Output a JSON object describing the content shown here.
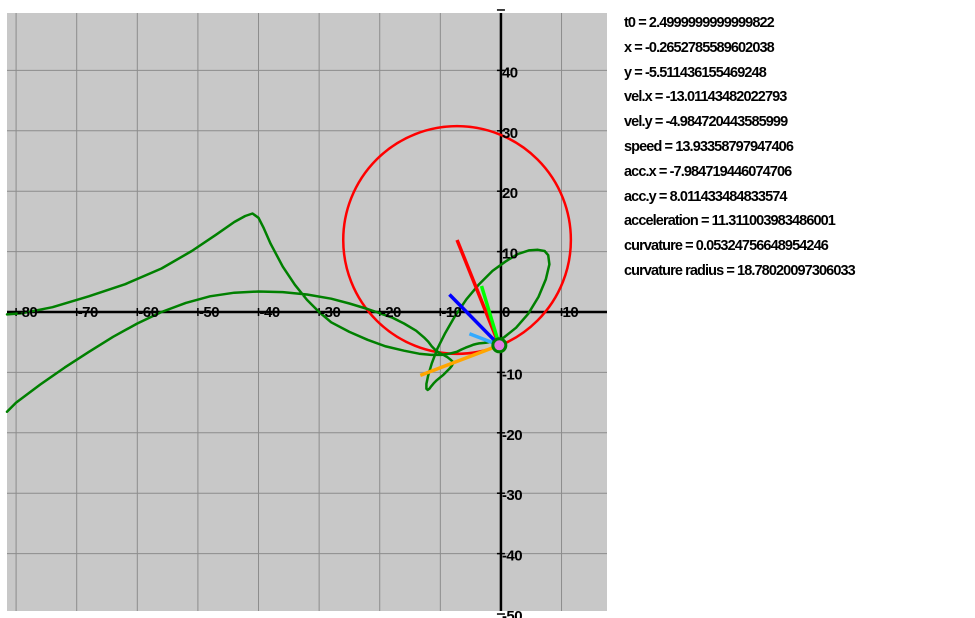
{
  "readout": {
    "t0": "t0 = 2.4999999999999822",
    "x": "x = -0.2652785589602038",
    "y": "y = -5.511436155469248",
    "vel_x": "vel.x = -13.01143482022793",
    "vel_y": "vel.y = -4.984720443585999",
    "speed": "speed = 13.93358797947406",
    "acc_x": "acc.x = -7.984719446074706",
    "acc_y": "acc.y = 8.011433484833574",
    "acceleration": "acceleration = 11.311003983486001",
    "curvature": "curvature = 0.05324756648954246",
    "curvature_radius": "curvature radius = 18.78020097306033"
  },
  "chart_data": {
    "type": "line",
    "xlim": [
      -81.5,
      17.5
    ],
    "ylim": [
      -49.5,
      49.5
    ],
    "grid": true,
    "background": "#c8c8c8",
    "grid_color": "#8c8c8c",
    "x_ticks": [
      -80,
      -70,
      -60,
      -50,
      -40,
      -30,
      -20,
      -10,
      0,
      10
    ],
    "y_ticks": [
      -50,
      -40,
      -30,
      -20,
      -10,
      10,
      20,
      30,
      40
    ],
    "x_tick_labels": [
      "-80",
      "-70",
      "-60",
      "-50",
      "-40",
      "-30",
      "-20",
      "-10",
      "0",
      "10"
    ],
    "y_tick_labels": [
      "-50",
      "-40",
      "-30",
      "-20",
      "-10",
      "10",
      "20",
      "30",
      "40"
    ],
    "trajectory": {
      "color": "#008000",
      "x": [
        -81.5,
        -79,
        -74,
        -68,
        -62,
        -56,
        -51,
        -47,
        -44,
        -42.2,
        -41,
        -40,
        -39.2,
        -38,
        -36,
        -34,
        -32,
        -30,
        -28,
        -25,
        -22,
        -19,
        -16,
        -13.5,
        -11.5,
        -9.8,
        -8.5,
        -7.3,
        -6.5,
        -5.8,
        -5,
        -4.5,
        -4.1,
        -3.6,
        -2.5,
        -1,
        0.5,
        2.5,
        4.5,
        6.2,
        7.4,
        8,
        7.8,
        7.2,
        6.1,
        4.6,
        2.8,
        0.8,
        -1.4,
        -3.6,
        -5.7,
        -7.6,
        -9.2,
        -10.5,
        -11.4,
        -12,
        -12.3,
        -12.3,
        -12.1,
        -11.8,
        -11.5,
        -11.1,
        -10.6,
        -10.1,
        -9.5,
        -9,
        -8.5,
        -8.1,
        -7.9,
        -8,
        -8.3,
        -8.8,
        -9.3,
        -9.9,
        -10.4,
        -10.9,
        -11.4,
        -12,
        -12.7,
        -14,
        -16,
        -18,
        -20,
        -22,
        -25,
        -28,
        -32,
        -36,
        -40,
        -44,
        -48,
        -52,
        -56,
        -60,
        -64,
        -68,
        -72,
        -76,
        -80,
        -81.5
      ],
      "y": [
        -0.4,
        -0.2,
        0.8,
        2.6,
        4.6,
        7.2,
        10.1,
        12.8,
        14.9,
        15.9,
        16.3,
        15.6,
        14,
        11.3,
        7.5,
        4.5,
        2,
        0,
        -1.7,
        -3.3,
        -4.6,
        -5.7,
        -6.4,
        -6.9,
        -7.1,
        -7.1,
        -6.9,
        -6.6,
        -6.2,
        -5.9,
        -5.6,
        -5.4,
        -5.3,
        -5.2,
        -5.1,
        -4.8,
        -4.2,
        -2.6,
        -0.3,
        2.5,
        5.4,
        7.9,
        9.4,
        10.1,
        10.3,
        10.2,
        9.6,
        8.4,
        6.8,
        4.6,
        2.1,
        -0.7,
        -3.5,
        -6.1,
        -8.5,
        -10.5,
        -11.9,
        -12.7,
        -12.9,
        -12.7,
        -12.3,
        -11.8,
        -11.3,
        -10.9,
        -10.4,
        -9.9,
        -9.4,
        -8.9,
        -8.5,
        -8.2,
        -7.9,
        -7.5,
        -7.2,
        -6.9,
        -6.6,
        -6.2,
        -5.7,
        -4.9,
        -4.2,
        -3.1,
        -1.9,
        -0.9,
        -0.2,
        0.5,
        1.4,
        2.2,
        2.9,
        3.3,
        3.4,
        3.2,
        2.6,
        1.5,
        0,
        -1.9,
        -4.1,
        -6.6,
        -9.2,
        -12,
        -15,
        -16.5
      ]
    },
    "osculating_circle": {
      "color": "#ff0000",
      "center": [
        -7.24,
        11.92
      ],
      "radius": 18.78020097306033
    },
    "point": {
      "x": -0.2652785589602038,
      "y": -5.511436155469248,
      "fill": "#e07fe0",
      "ring": "#008000"
    },
    "vectors": [
      {
        "name": "red",
        "color": "#ff0000",
        "to": [
          -7.24,
          11.92
        ]
      },
      {
        "name": "green",
        "color": "#00ff00",
        "to": [
          -3.2,
          4.3
        ]
      },
      {
        "name": "blue",
        "color": "#0000ff",
        "to": [
          -8.5,
          2.9
        ]
      },
      {
        "name": "cyan",
        "color": "#33aaff",
        "to": [
          -5.2,
          -3.6
        ]
      },
      {
        "name": "orange",
        "color": "#ffa500",
        "to": [
          -13.3,
          -10.5
        ]
      }
    ]
  }
}
